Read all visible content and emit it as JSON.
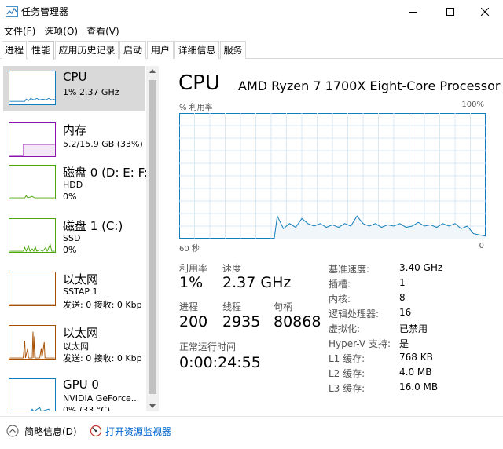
{
  "window": {
    "title": "任务管理器"
  },
  "menu": [
    "文件(F)",
    "选项(O)",
    "查看(V)"
  ],
  "tabs": [
    "进程",
    "性能",
    "应用历史记录",
    "启动",
    "用户",
    "详细信息",
    "服务"
  ],
  "active_tab": "性能",
  "resources": [
    {
      "name": "CPU",
      "line1": "1% 2.37 GHz",
      "line2": "",
      "color": "#117dbb"
    },
    {
      "name": "内存",
      "line1": "5.2/15.9 GB (33%)",
      "line2": "",
      "color": "#8b12ae"
    },
    {
      "name": "磁盘 0 (D: E: F:",
      "line1": "HDD",
      "line2": "0%",
      "color": "#4da60c"
    },
    {
      "name": "磁盘 1 (C:)",
      "line1": "SSD",
      "line2": "0%",
      "color": "#4da60c"
    },
    {
      "name": "以太网",
      "line1": "SSTAP 1",
      "line2": "发送: 0 接收: 0 Kbp",
      "color": "#a74f01"
    },
    {
      "name": "以太网",
      "line1": "以太网",
      "line2": "发送: 0 接收: 0 Kbp",
      "color": "#a74f01"
    },
    {
      "name": "GPU 0",
      "line1": "NVIDIA GeForce...",
      "line2": "0% (33 °C)",
      "color": "#117dbb"
    }
  ],
  "cpu": {
    "title": "CPU",
    "model": "AMD Ryzen 7 1700X Eight-Core Processor",
    "graph_label_left": "% 利用率",
    "graph_label_right": "100%",
    "axis_left": "60 秒",
    "axis_right": "0",
    "utilization_series": [
      0,
      0,
      0,
      0,
      0,
      0,
      0,
      0,
      0,
      0,
      0,
      0,
      0,
      0,
      0,
      0,
      0,
      0,
      0,
      0,
      0,
      0,
      0,
      0,
      0,
      0,
      0,
      0,
      0,
      0,
      0,
      0,
      0,
      0,
      0,
      0,
      0,
      0,
      0,
      0,
      0,
      0,
      0,
      0,
      0,
      0,
      0,
      0,
      0,
      0,
      0,
      0,
      0,
      0,
      0,
      0,
      0,
      0,
      0,
      0,
      0,
      0,
      0,
      0,
      0,
      0,
      0,
      0,
      0,
      0,
      0,
      0,
      0,
      0,
      0,
      0,
      0,
      0,
      0,
      0,
      0,
      0,
      0,
      0,
      0,
      0,
      0,
      0,
      0,
      0,
      0,
      0,
      0,
      0,
      0,
      0,
      0,
      0,
      0,
      0,
      0,
      0,
      0,
      0,
      0,
      0,
      0,
      0,
      0,
      0,
      0,
      0,
      0,
      0,
      0,
      0,
      0,
      0,
      0,
      0,
      0,
      0,
      0,
      0,
      0,
      0,
      0,
      0,
      0,
      0,
      0,
      0,
      0,
      0,
      0,
      0,
      0,
      0,
      0,
      0,
      0,
      0,
      0,
      0,
      0,
      0,
      0,
      0,
      0,
      0,
      0,
      0,
      0,
      0,
      0,
      0,
      0,
      0,
      0,
      0
    ]
  },
  "cpu_stats": {
    "util_label": "利用率",
    "util_value": "1%",
    "speed_label": "速度",
    "speed_value": "2.37 GHz",
    "proc_label": "进程",
    "proc_value": "200",
    "threads_label": "线程",
    "threads_value": "2935",
    "handles_label": "句柄",
    "handles_value": "80868",
    "uptime_label": "正常运行时间",
    "uptime_value": "0:00:24:55"
  },
  "cpu_specs": [
    {
      "label": "基准速度:",
      "value": "3.40 GHz"
    },
    {
      "label": "插槽:",
      "value": "1"
    },
    {
      "label": "内核:",
      "value": "8"
    },
    {
      "label": "逻辑处理器:",
      "value": "16"
    },
    {
      "label": "虚拟化:",
      "value": "已禁用"
    },
    {
      "label": "Hyper-V 支持:",
      "value": "是"
    },
    {
      "label": "L1 缓存:",
      "value": "768 KB"
    },
    {
      "label": "L2 缓存:",
      "value": "4.0 MB"
    },
    {
      "label": "L3 缓存:",
      "value": "16.0 MB"
    }
  ],
  "footer": {
    "brief": "简略信息(D)",
    "resmon": "打开资源监视器"
  },
  "colors": {
    "cpu": "#117dbb",
    "cpu_fill": "#f1f6fa",
    "grid": "#d9eaf4",
    "selected": "#d9d9d9"
  }
}
